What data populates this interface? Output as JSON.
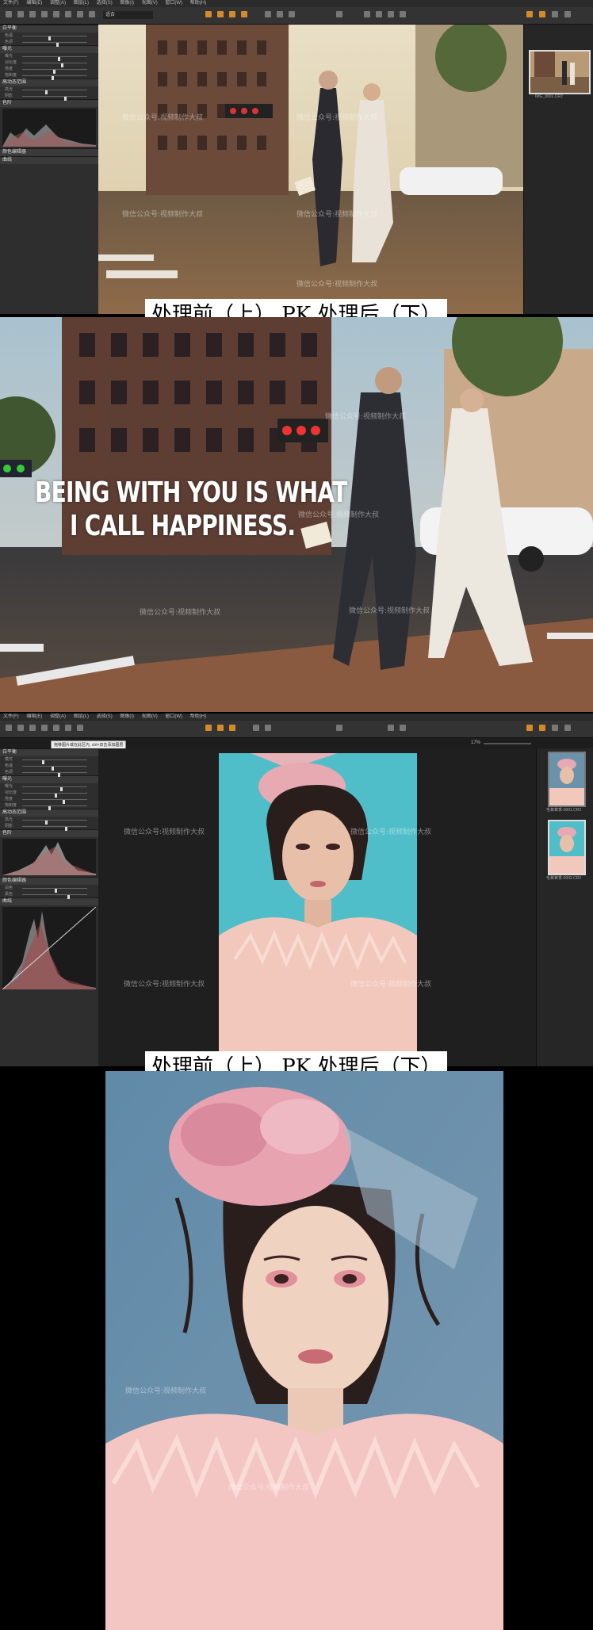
{
  "editor1": {
    "menu": [
      "文件(F)",
      "编辑(E)",
      "调整(A)",
      "图层(L)",
      "选择(S)",
      "图像(I)",
      "视图(V)",
      "窗口(W)",
      "帮助(H)"
    ],
    "zoom": "适合",
    "panel_sections": [
      "白平衡",
      "曝光",
      "高动态范围",
      "色阶",
      "颜色编辑器",
      "曲线"
    ],
    "rows": [
      "色温",
      "色调",
      "曝光",
      "对比度",
      "亮度",
      "饱和度",
      "高光",
      "阴影"
    ],
    "thumb_label": "IMG_0001.CR2"
  },
  "caption1": "处理前（上）  PK 处理后（下）",
  "overlay": {
    "line1": "BEING WITH YOU IS WHAT",
    "line2": "I CALL HAPPINESS."
  },
  "editor2": {
    "menu": [
      "文件(F)",
      "编辑(E)",
      "调整(A)",
      "图层(L)",
      "选择(S)",
      "图像(I)",
      "视图(V)",
      "窗口(W)",
      "帮助(H)"
    ],
    "tooltip": "拖移图片或在此区内, ctrl+双击添加图层",
    "zoom": "17%",
    "panel_sections": [
      "白平衡",
      "曝光",
      "高动态范围",
      "色阶",
      "颜色编辑器",
      "曲线"
    ],
    "rows": [
      "模式",
      "色温",
      "色调",
      "曝光",
      "对比度",
      "亮度",
      "饱和度",
      "高光",
      "阴影",
      "白色",
      "黑色"
    ],
    "thumb_labels": [
      "毛茸茸季-0001.CR2",
      "毛茸茸季-0002.CR2"
    ]
  },
  "caption2": "处理前（上）  PK 处理后（下）",
  "watermark": "微信公众号:视频制作大叔",
  "colors": {
    "accent": "#d58a2a",
    "panel": "#2e2e2e",
    "teal_bg": "#4fbec8",
    "blue_bg": "#6a8ba6"
  },
  "icons": [
    "cursor-icon",
    "crop-icon",
    "rotate-icon",
    "brush-icon",
    "eraser-icon",
    "text-icon",
    "upload-icon",
    "undo-icon",
    "redo-icon",
    "warning-icon",
    "gear-icon",
    "help-icon"
  ]
}
